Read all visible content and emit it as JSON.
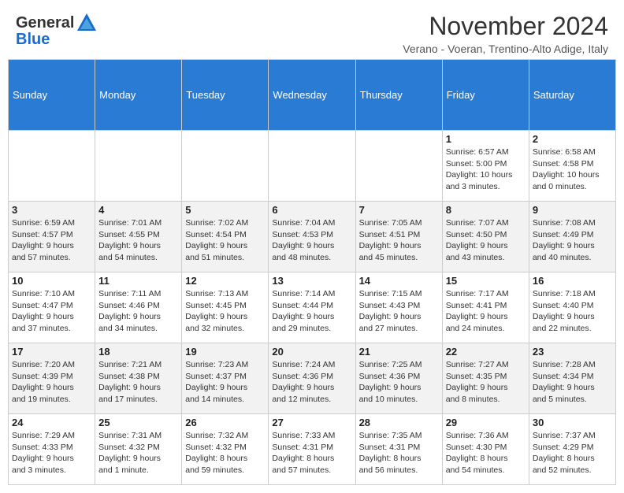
{
  "header": {
    "logo_general": "General",
    "logo_blue": "Blue",
    "month_title": "November 2024",
    "subtitle": "Verano - Voeran, Trentino-Alto Adige, Italy"
  },
  "days_of_week": [
    "Sunday",
    "Monday",
    "Tuesday",
    "Wednesday",
    "Thursday",
    "Friday",
    "Saturday"
  ],
  "weeks": [
    {
      "days": [
        {
          "num": "",
          "info": "",
          "empty": true
        },
        {
          "num": "",
          "info": "",
          "empty": true
        },
        {
          "num": "",
          "info": "",
          "empty": true
        },
        {
          "num": "",
          "info": "",
          "empty": true
        },
        {
          "num": "",
          "info": "",
          "empty": true
        },
        {
          "num": "1",
          "info": "Sunrise: 6:57 AM\nSunset: 5:00 PM\nDaylight: 10 hours\nand 3 minutes."
        },
        {
          "num": "2",
          "info": "Sunrise: 6:58 AM\nSunset: 4:58 PM\nDaylight: 10 hours\nand 0 minutes."
        }
      ]
    },
    {
      "days": [
        {
          "num": "3",
          "info": "Sunrise: 6:59 AM\nSunset: 4:57 PM\nDaylight: 9 hours\nand 57 minutes."
        },
        {
          "num": "4",
          "info": "Sunrise: 7:01 AM\nSunset: 4:55 PM\nDaylight: 9 hours\nand 54 minutes."
        },
        {
          "num": "5",
          "info": "Sunrise: 7:02 AM\nSunset: 4:54 PM\nDaylight: 9 hours\nand 51 minutes."
        },
        {
          "num": "6",
          "info": "Sunrise: 7:04 AM\nSunset: 4:53 PM\nDaylight: 9 hours\nand 48 minutes."
        },
        {
          "num": "7",
          "info": "Sunrise: 7:05 AM\nSunset: 4:51 PM\nDaylight: 9 hours\nand 45 minutes."
        },
        {
          "num": "8",
          "info": "Sunrise: 7:07 AM\nSunset: 4:50 PM\nDaylight: 9 hours\nand 43 minutes."
        },
        {
          "num": "9",
          "info": "Sunrise: 7:08 AM\nSunset: 4:49 PM\nDaylight: 9 hours\nand 40 minutes."
        }
      ]
    },
    {
      "days": [
        {
          "num": "10",
          "info": "Sunrise: 7:10 AM\nSunset: 4:47 PM\nDaylight: 9 hours\nand 37 minutes."
        },
        {
          "num": "11",
          "info": "Sunrise: 7:11 AM\nSunset: 4:46 PM\nDaylight: 9 hours\nand 34 minutes."
        },
        {
          "num": "12",
          "info": "Sunrise: 7:13 AM\nSunset: 4:45 PM\nDaylight: 9 hours\nand 32 minutes."
        },
        {
          "num": "13",
          "info": "Sunrise: 7:14 AM\nSunset: 4:44 PM\nDaylight: 9 hours\nand 29 minutes."
        },
        {
          "num": "14",
          "info": "Sunrise: 7:15 AM\nSunset: 4:43 PM\nDaylight: 9 hours\nand 27 minutes."
        },
        {
          "num": "15",
          "info": "Sunrise: 7:17 AM\nSunset: 4:41 PM\nDaylight: 9 hours\nand 24 minutes."
        },
        {
          "num": "16",
          "info": "Sunrise: 7:18 AM\nSunset: 4:40 PM\nDaylight: 9 hours\nand 22 minutes."
        }
      ]
    },
    {
      "days": [
        {
          "num": "17",
          "info": "Sunrise: 7:20 AM\nSunset: 4:39 PM\nDaylight: 9 hours\nand 19 minutes."
        },
        {
          "num": "18",
          "info": "Sunrise: 7:21 AM\nSunset: 4:38 PM\nDaylight: 9 hours\nand 17 minutes."
        },
        {
          "num": "19",
          "info": "Sunrise: 7:23 AM\nSunset: 4:37 PM\nDaylight: 9 hours\nand 14 minutes."
        },
        {
          "num": "20",
          "info": "Sunrise: 7:24 AM\nSunset: 4:36 PM\nDaylight: 9 hours\nand 12 minutes."
        },
        {
          "num": "21",
          "info": "Sunrise: 7:25 AM\nSunset: 4:36 PM\nDaylight: 9 hours\nand 10 minutes."
        },
        {
          "num": "22",
          "info": "Sunrise: 7:27 AM\nSunset: 4:35 PM\nDaylight: 9 hours\nand 8 minutes."
        },
        {
          "num": "23",
          "info": "Sunrise: 7:28 AM\nSunset: 4:34 PM\nDaylight: 9 hours\nand 5 minutes."
        }
      ]
    },
    {
      "days": [
        {
          "num": "24",
          "info": "Sunrise: 7:29 AM\nSunset: 4:33 PM\nDaylight: 9 hours\nand 3 minutes."
        },
        {
          "num": "25",
          "info": "Sunrise: 7:31 AM\nSunset: 4:32 PM\nDaylight: 9 hours\nand 1 minute."
        },
        {
          "num": "26",
          "info": "Sunrise: 7:32 AM\nSunset: 4:32 PM\nDaylight: 8 hours\nand 59 minutes."
        },
        {
          "num": "27",
          "info": "Sunrise: 7:33 AM\nSunset: 4:31 PM\nDaylight: 8 hours\nand 57 minutes."
        },
        {
          "num": "28",
          "info": "Sunrise: 7:35 AM\nSunset: 4:31 PM\nDaylight: 8 hours\nand 56 minutes."
        },
        {
          "num": "29",
          "info": "Sunrise: 7:36 AM\nSunset: 4:30 PM\nDaylight: 8 hours\nand 54 minutes."
        },
        {
          "num": "30",
          "info": "Sunrise: 7:37 AM\nSunset: 4:29 PM\nDaylight: 8 hours\nand 52 minutes."
        }
      ]
    }
  ]
}
